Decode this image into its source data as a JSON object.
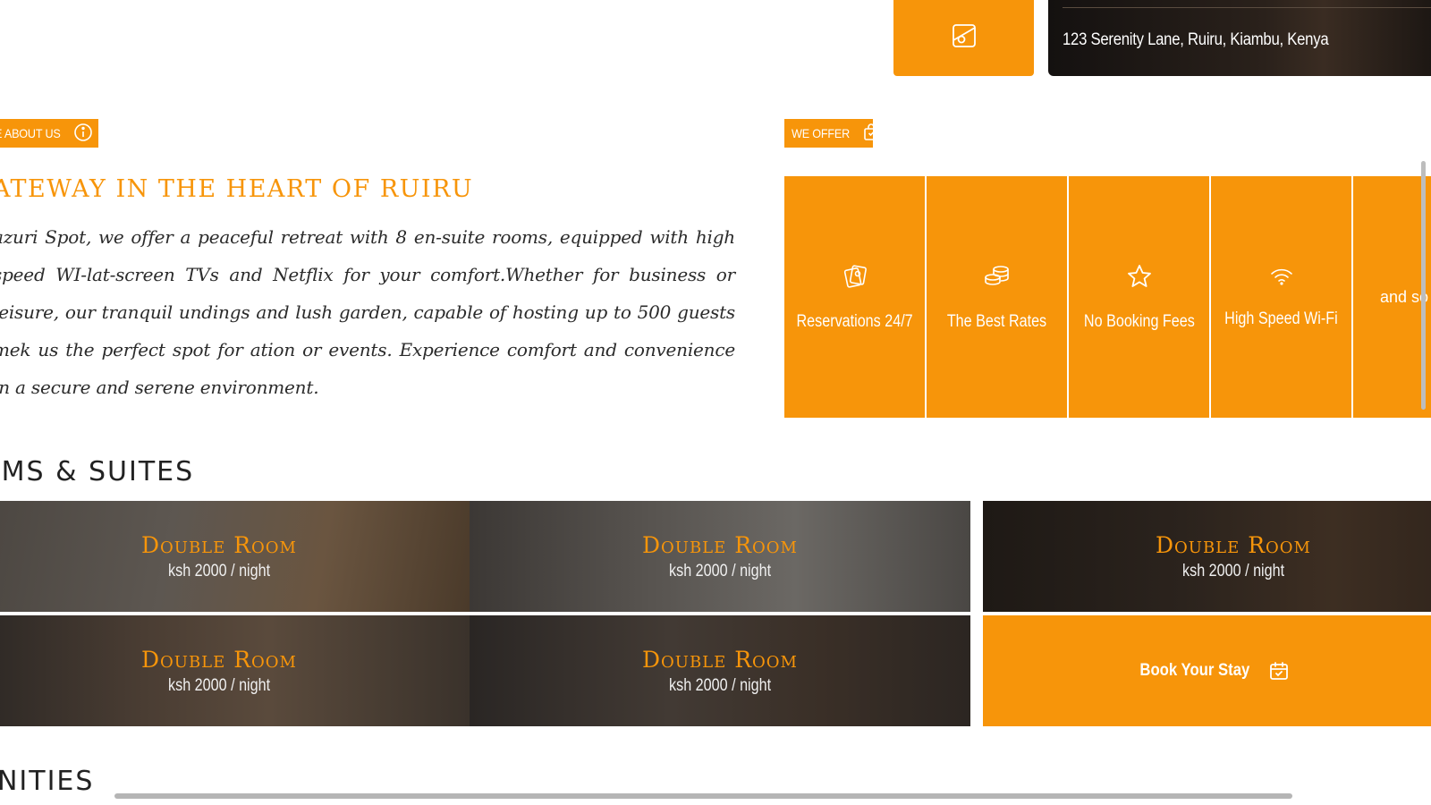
{
  "top_bar": {
    "address": "123 Serenity Lane, Ruiru, Kiambu, Kenya",
    "icon": "map-location-icon"
  },
  "about": {
    "tag_label": "E ABOUT US",
    "tag_icon": "info-icon",
    "heading": "ATEWAY IN THE HEART  OF RUIRU",
    "body": "azuri Spot, we offer a peaceful retreat with 8 en-suite rooms, equipped with high speed WI-lat-screen TVs and Netflix for your comfort.Whether for business or leisure, our tranquil undings and lush garden, capable of hosting up to 500 guests mek us the perfect spot for ation or events. Experience comfort and convenience in a secure and serene environment."
  },
  "offers": {
    "tag_label": "WE OFFER",
    "tag_icon": "shopping-bag-icon",
    "items": [
      {
        "label": "Reservations 24/7",
        "icon": "tickets-icon"
      },
      {
        "label": "The Best Rates",
        "icon": "coins-icon"
      },
      {
        "label": "No Booking Fees",
        "icon": "star-icon"
      },
      {
        "label": "High Speed Wi-Fi",
        "icon": "wifi-icon"
      },
      {
        "label": "and so mor",
        "icon": ""
      }
    ]
  },
  "rooms": {
    "title": "OMS & SUITES",
    "items": [
      {
        "name": "Double Room",
        "price": "ksh 2000 / night"
      },
      {
        "name": "Double Room",
        "price": "ksh 2000 / night"
      },
      {
        "name": "Double Room",
        "price": "ksh 2000 / night"
      },
      {
        "name": "Double Room",
        "price": "ksh 2000 / night"
      },
      {
        "name": "Double Room",
        "price": "ksh 2000 / night"
      }
    ],
    "book_label": "Book Your Stay",
    "book_icon": "calendar-check-icon"
  },
  "amenities": {
    "title": "ENITIES"
  },
  "colors": {
    "accent": "#f7950a",
    "text_dark": "#222222"
  }
}
